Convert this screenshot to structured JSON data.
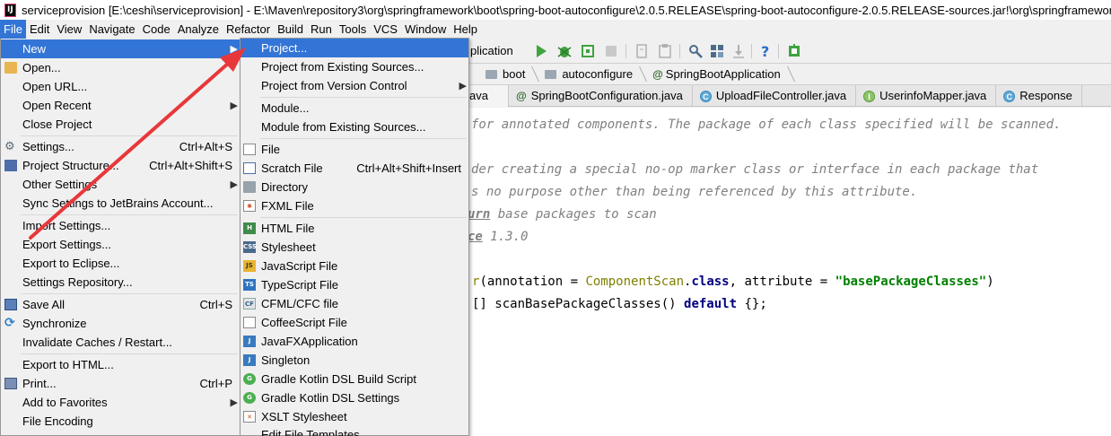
{
  "window": {
    "title": "serviceprovision [E:\\ceshi\\serviceprovision] - E:\\Maven\\repository3\\org\\springframework\\boot\\spring-boot-autoconfigure\\2.0.5.RELEASE\\spring-boot-autoconfigure-2.0.5.RELEASE-sources.jar!\\org\\springframework\\boot\\autoconfigure\\SpringBootApplication.java"
  },
  "menubar": [
    "File",
    "Edit",
    "View",
    "Navigate",
    "Code",
    "Analyze",
    "Refactor",
    "Build",
    "Run",
    "Tools",
    "VCS",
    "Window",
    "Help"
  ],
  "toolbar": {
    "run_config": "plication"
  },
  "breadcrumb": [
    "boot",
    "autoconfigure",
    "SpringBootApplication"
  ],
  "tabs": [
    {
      "label": "ava"
    },
    {
      "label": "SpringBootConfiguration.java"
    },
    {
      "label": "UploadFileController.java"
    },
    {
      "label": "UserinfoMapper.java"
    },
    {
      "label": "Response"
    }
  ],
  "editor": {
    "line1": "for annotated components. The package of each class specified will be scanned.",
    "line2": "der creating a special no-op marker class or interface in each package that",
    "line3": "s no purpose other than being referenced by this attribute.",
    "line4_tag": "urn",
    "line4_text": " base packages to scan",
    "line5_tag": "ce",
    "line5_text": " 1.3.0",
    "line6_a": "r",
    "line6_b": "(annotation = ",
    "line6_c": "ComponentScan",
    "line6_d": ".",
    "line6_e": "class",
    "line6_f": ", attribute = ",
    "line6_g": "\"basePackageClasses\"",
    "line6_h": ")",
    "line7_a": "[] scanBasePackageClasses() ",
    "line7_b": "default",
    "line7_c": " {};"
  },
  "file_menu": {
    "new": "New",
    "open": "Open...",
    "open_url": "Open URL...",
    "open_recent": "Open Recent",
    "close_project": "Close Project",
    "settings": "Settings...",
    "settings_sc": "Ctrl+Alt+S",
    "project_structure": "Project Structure...",
    "project_structure_sc": "Ctrl+Alt+Shift+S",
    "other_settings": "Other Settings",
    "sync_settings": "Sync Settings to JetBrains Account...",
    "import_settings": "Import Settings...",
    "export_settings": "Export Settings...",
    "export_eclipse": "Export to Eclipse...",
    "settings_repo": "Settings Repository...",
    "save_all": "Save All",
    "save_all_sc": "Ctrl+S",
    "synchronize": "Synchronize",
    "invalidate": "Invalidate Caches / Restart...",
    "export_html": "Export to HTML...",
    "print": "Print...",
    "print_sc": "Ctrl+P",
    "add_favorites": "Add to Favorites",
    "file_encoding": "File Encoding"
  },
  "new_menu": {
    "project": "Project...",
    "from_existing": "Project from Existing Sources...",
    "from_vcs": "Project from Version Control",
    "module": "Module...",
    "module_existing": "Module from Existing Sources...",
    "file": "File",
    "scratch": "Scratch File",
    "scratch_sc": "Ctrl+Alt+Shift+Insert",
    "directory": "Directory",
    "fxml": "FXML File",
    "html": "HTML File",
    "stylesheet": "Stylesheet",
    "javascript": "JavaScript File",
    "typescript": "TypeScript File",
    "cfml": "CFML/CFC file",
    "coffeescript": "CoffeeScript File",
    "javafx": "JavaFXApplication",
    "singleton": "Singleton",
    "gradle_build": "Gradle Kotlin DSL Build Script",
    "gradle_settings": "Gradle Kotlin DSL Settings",
    "xslt": "XSLT Stylesheet",
    "edit_templates": "Edit File Templates..."
  },
  "colors": {
    "highlight": "#3375d6",
    "arrow": "#e8373a"
  }
}
